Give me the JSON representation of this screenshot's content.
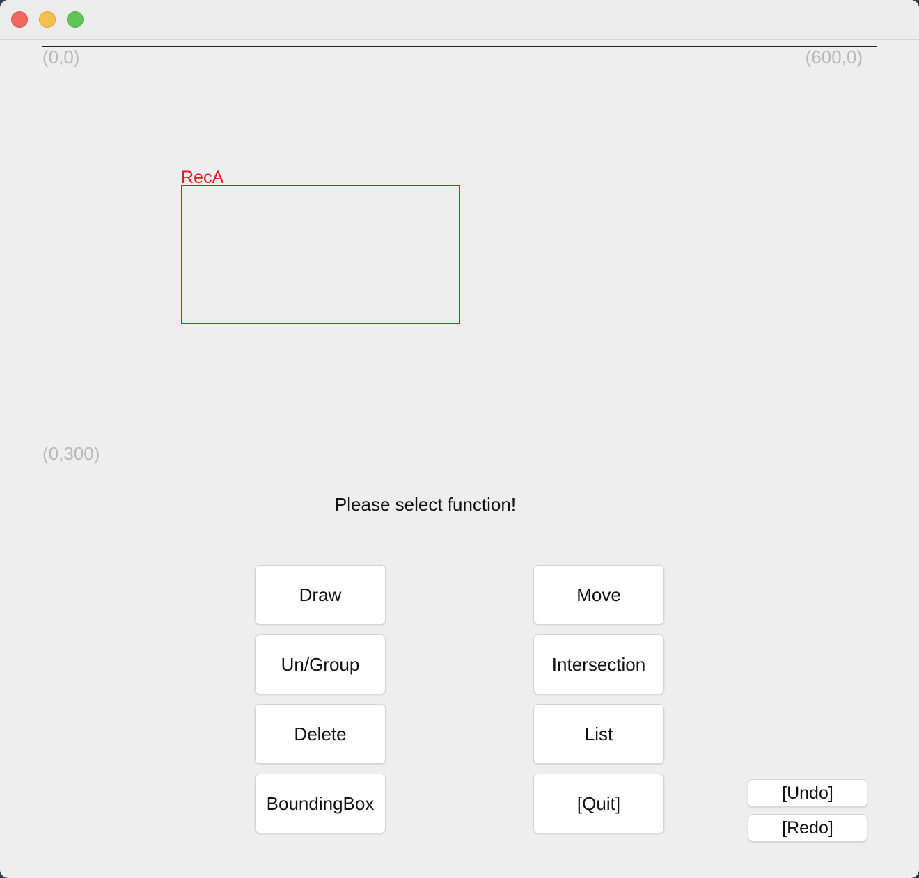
{
  "window": {
    "controls": {
      "close": "close-button",
      "minimize": "minimize-button",
      "maximize": "maximize-button"
    }
  },
  "canvas": {
    "corner_top_left": "(0,0)",
    "corner_top_right": "(600,0)",
    "corner_bottom_left": "(0,300)",
    "shapes": [
      {
        "label": "RecA",
        "color": "#e8141c"
      }
    ]
  },
  "status": {
    "message": "Please select function!"
  },
  "buttons": {
    "draw": "Draw",
    "move": "Move",
    "ungroup": "Un/Group",
    "intersection": "Intersection",
    "delete": "Delete",
    "list": "List",
    "bounding_box": "BoundingBox",
    "quit": "[Quit]",
    "undo": "[Undo]",
    "redo": "[Redo]"
  }
}
